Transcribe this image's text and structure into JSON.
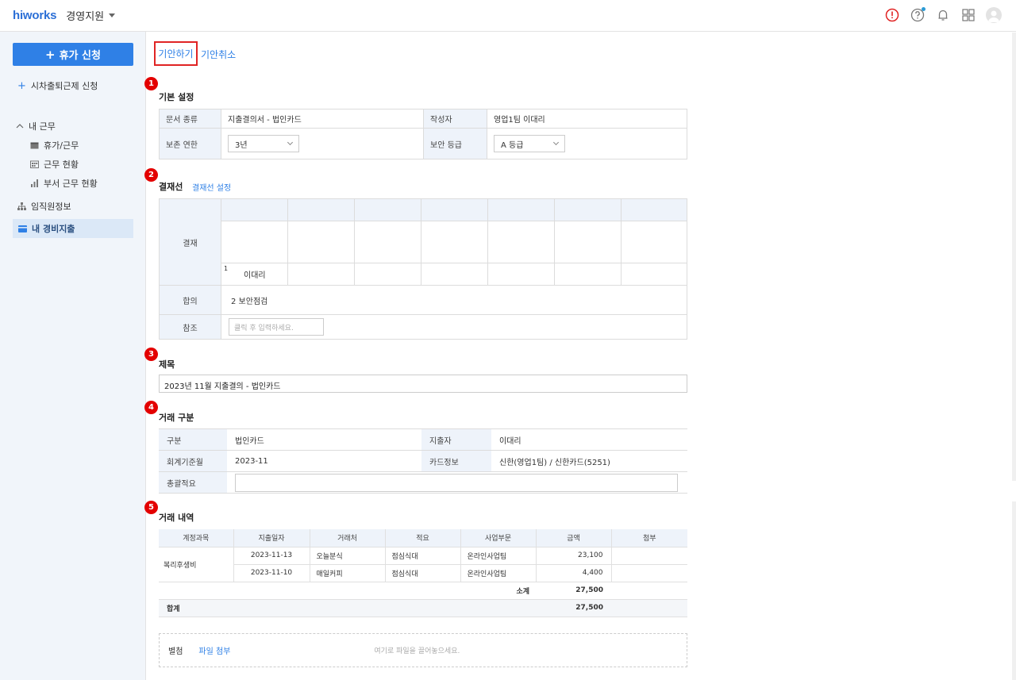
{
  "app": {
    "logo": "hiworks",
    "title": "경영지원"
  },
  "header": {
    "icons": [
      "alert-icon",
      "help-icon",
      "bell-icon",
      "apps-grid-icon",
      "avatar"
    ]
  },
  "sidebar": {
    "primary_button": "휴가 신청",
    "link_flex": "시차출퇴근제 신청",
    "group_label": "내 근무",
    "sub_items": [
      "휴가/근무",
      "근무 현황",
      "부서 근무 현황"
    ],
    "org_label": "임직원정보",
    "active_label": "내 경비지출"
  },
  "tabs": {
    "draft": "기안하기",
    "cancel": "기안취소"
  },
  "sections": {
    "basic": {
      "number": "1",
      "title": "기본 설정"
    },
    "approval": {
      "number": "2",
      "title": "결재선",
      "link": "결재선 설정"
    },
    "subject": {
      "number": "3",
      "title": "제목"
    },
    "deal": {
      "number": "4",
      "title": "거래 구분"
    },
    "items": {
      "number": "5",
      "title": "거래 내역"
    }
  },
  "basic": {
    "doc_type_label": "문서 종류",
    "doc_type_value": "지출결의서 - 법인카드",
    "writer_label": "작성자",
    "writer_value": "영업1팀 이대리",
    "retention_label": "보존 연한",
    "retention_value": "3년",
    "security_label": "보안 등급",
    "security_value": "A 등급"
  },
  "approval": {
    "approve_label": "결재",
    "approver_index": "1",
    "approver_name": "이대리",
    "agree_label": "합의",
    "agree_value": "2 보안점검",
    "ref_label": "참조",
    "ref_placeholder": "클릭 후 입력하세요."
  },
  "subject": {
    "value": "2023년 11월 지출결의 - 법인카드"
  },
  "deal": {
    "type_label": "구분",
    "type_value": "법인카드",
    "spender_label": "지출자",
    "spender_value": "이대리",
    "month_label": "회계기준월",
    "month_value": "2023-11",
    "card_label": "카드정보",
    "card_value": "신한(영업1팀) / 신한카드(5251)",
    "summary_label": "총괄적요"
  },
  "items": {
    "headers": [
      "계정과목",
      "지출일자",
      "거래처",
      "적요",
      "사업부문",
      "금액",
      "첨부"
    ],
    "account": "복리후생비",
    "rows": [
      {
        "date": "2023-11-13",
        "vendor": "오늘분식",
        "memo": "점심식대",
        "division": "온라인사업팀",
        "amount": "23,100"
      },
      {
        "date": "2023-11-10",
        "vendor": "매일커피",
        "memo": "점심식대",
        "division": "온라인사업팀",
        "amount": "4,400"
      }
    ],
    "subtotal_label": "소계",
    "subtotal_value": "27,500",
    "total_label": "합계",
    "total_value": "27,500"
  },
  "attachment": {
    "label": "별첨",
    "button": "파일 첨부",
    "hint": "여기로 파일을 끌어놓으세요."
  }
}
